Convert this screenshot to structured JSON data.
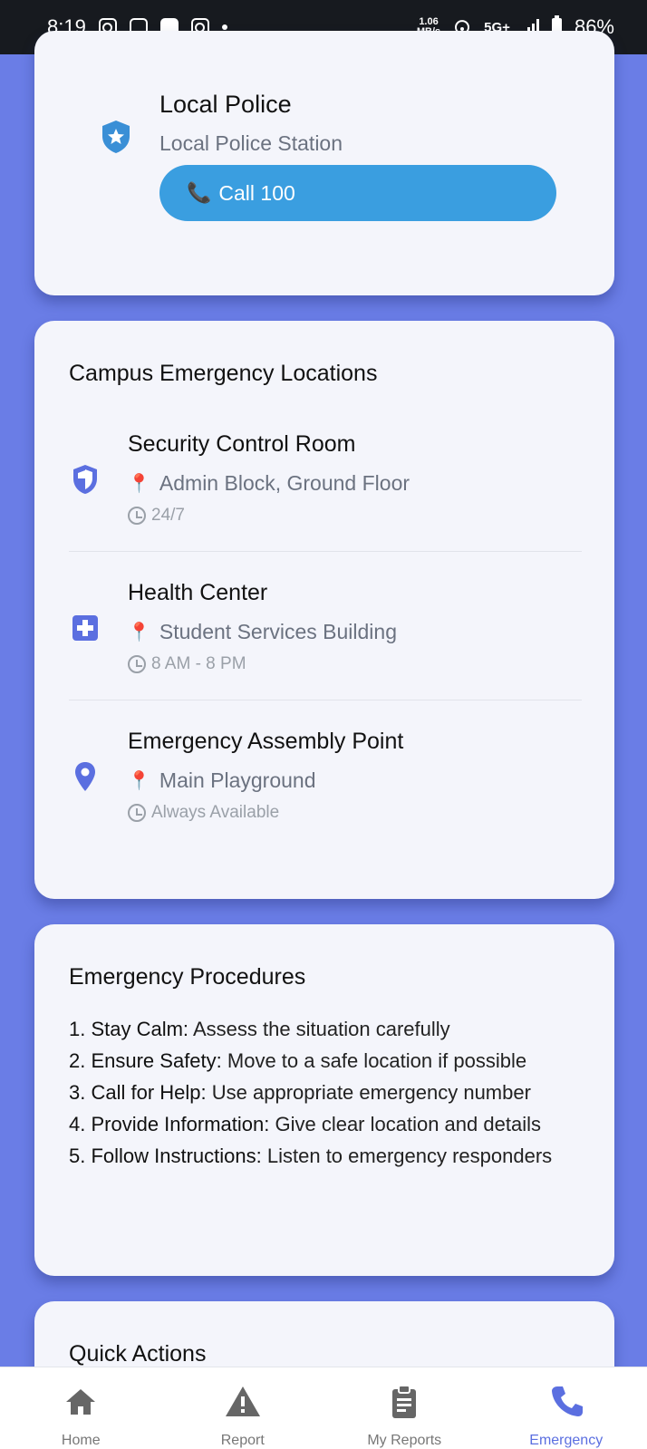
{
  "status_bar": {
    "time": "8:19",
    "speed_top": "1.06",
    "speed_bottom": "MB/s",
    "network": "5G+",
    "battery": "86%"
  },
  "police_card": {
    "name": "Local Police",
    "subtitle": "Local Police Station",
    "call_label": "Call 100",
    "icon": "police-shield-star-icon"
  },
  "locations_card": {
    "title": "Campus Emergency Locations",
    "items": [
      {
        "name": "Security Control Room",
        "place": "Admin Block, Ground Floor",
        "hours": "24/7",
        "icon": "shield-icon"
      },
      {
        "name": "Health Center",
        "place": "Student Services Building",
        "hours": "8 AM - 8 PM",
        "icon": "medical-plus-icon"
      },
      {
        "name": "Emergency Assembly Point",
        "place": "Main Playground",
        "hours": "Always Available",
        "icon": "location-pin-icon"
      }
    ]
  },
  "procedures_card": {
    "title": "Emergency Procedures",
    "steps": [
      {
        "label": "1. Stay Calm:",
        "text": "Assess the situation carefully"
      },
      {
        "label": "2. Ensure Safety:",
        "text": "Move to a safe location if possible"
      },
      {
        "label": "3. Call for Help:",
        "text": "Use appropriate emergency number"
      },
      {
        "label": "4. Provide Information:",
        "text": "Give clear location and details"
      },
      {
        "label": "5. Follow Instructions:",
        "text": "Listen to emergency responders"
      }
    ]
  },
  "quick_card": {
    "title": "Quick Actions"
  },
  "bottom_nav": {
    "items": [
      {
        "label": "Home",
        "icon": "home-icon"
      },
      {
        "label": "Report",
        "icon": "warning-icon"
      },
      {
        "label": "My Reports",
        "icon": "clipboard-icon"
      },
      {
        "label": "Emergency",
        "icon": "phone-icon"
      }
    ],
    "active": "Emergency"
  },
  "colors": {
    "background": "#6a7de6",
    "call_button": "#3a9ee0",
    "icon_blue": "#5b6fe0",
    "nav_active": "#5b6fe0"
  }
}
